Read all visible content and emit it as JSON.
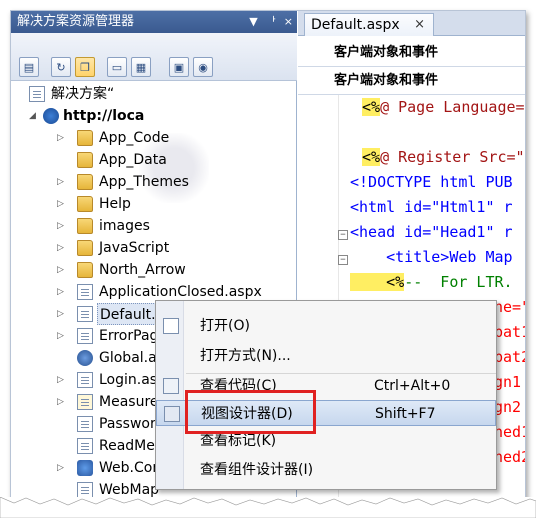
{
  "solution_explorer": {
    "title": "解决方案资源管理器",
    "title_controls": [
      "▼",
      "ᅡ",
      "×"
    ],
    "root_label": "解决方案“",
    "project_label": "http://loca",
    "items": [
      {
        "label": "App_Code",
        "icon": "folder-icon"
      },
      {
        "label": "App_Data",
        "icon": "folder-icon"
      },
      {
        "label": "App_Themes",
        "icon": "folder-icon"
      },
      {
        "label": "Help",
        "icon": "folder-icon"
      },
      {
        "label": "images",
        "icon": "folder-icon"
      },
      {
        "label": "JavaScript",
        "icon": "folder-icon"
      },
      {
        "label": "North_Arrow",
        "icon": "folder-icon"
      },
      {
        "label": "ApplicationClosed.aspx",
        "icon": "aspx-page-icon"
      },
      {
        "label": "Default.as",
        "icon": "aspx-page-icon"
      },
      {
        "label": "ErrorPage",
        "icon": "aspx-page-icon"
      },
      {
        "label": "Global.as",
        "icon": "global-asax-icon"
      },
      {
        "label": "Login.asp",
        "icon": "aspx-page-icon"
      },
      {
        "label": "Measure.",
        "icon": "aspx-page-icon"
      },
      {
        "label": "Passwor",
        "icon": "aspx-page-icon"
      },
      {
        "label": "ReadMe.t",
        "icon": "text-file-icon"
      },
      {
        "label": "Web.Con",
        "icon": "config-file-icon"
      },
      {
        "label": "WebMap",
        "icon": "aspx-page-icon"
      }
    ]
  },
  "editor": {
    "tab_label": "Default.aspx",
    "tab_close": "×",
    "combo1": "客户端对象和事件",
    "combo2": "客户端对象和事件",
    "code_lines": [
      {
        "t1": "<%",
        "t2": "@ Page Language="
      },
      {
        "t1": "",
        "t2": ""
      },
      {
        "t1": "<%",
        "t2": "@ Register Src=\""
      },
      {
        "t1": "<!DOCTYPE html PUB",
        "t2": ""
      },
      {
        "t1": "<html id=\"Html1\" r",
        "t2": ""
      },
      {
        "t1": "<head id=\"Head1\" r",
        "t2": ""
      },
      {
        "t1": "    <title>Web Map",
        "t2": ""
      },
      {
        "t1": "    <%",
        "t2": "--  For LTR."
      },
      {
        "t1": "",
        "t2": "ne=\""
      },
      {
        "t1": "",
        "t2": "bat1"
      },
      {
        "t1": "",
        "t2": "bat2"
      },
      {
        "t1": "",
        "t2": "gn1"
      },
      {
        "t1": "",
        "t2": "gn2"
      },
      {
        "t1": "",
        "t2": "ned1"
      },
      {
        "t1": "",
        "t2": "ned2"
      }
    ]
  },
  "context_menu": {
    "items": [
      {
        "label": "打开(O)",
        "shortcut": ""
      },
      {
        "label": "打开方式(N)...",
        "shortcut": ""
      },
      {
        "label": "查看代码(C)",
        "shortcut": "Ctrl+Alt+0"
      },
      {
        "label": "视图设计器(D)",
        "shortcut": "Shift+F7"
      },
      {
        "label": "查看标记(K)",
        "shortcut": ""
      },
      {
        "label": "查看组件设计器(I)",
        "shortcut": ""
      }
    ],
    "highlight_color": "#e02121"
  }
}
